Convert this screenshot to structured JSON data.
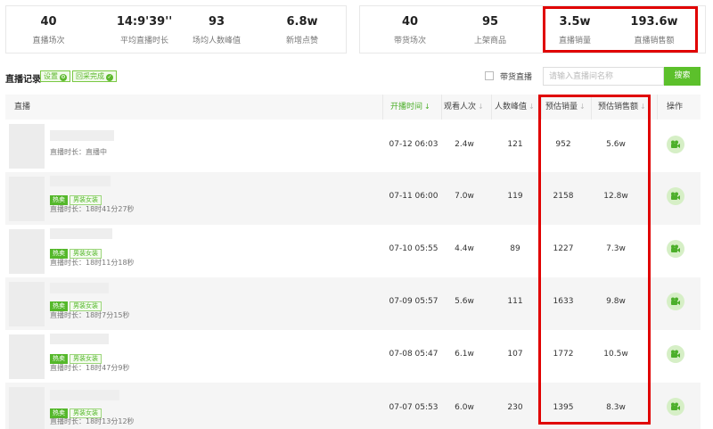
{
  "stats_left": [
    {
      "value": "40",
      "label": "直播场次"
    },
    {
      "value": "14:9'39''",
      "label": "平均直播时长"
    },
    {
      "value": "93",
      "label": "场均人数峰值"
    },
    {
      "value": "6.8w",
      "label": "新增点赞"
    }
  ],
  "stats_right": [
    {
      "value": "40",
      "label": "带货场次"
    },
    {
      "value": "95",
      "label": "上架商品"
    },
    {
      "value": "3.5w",
      "label": "直播销量"
    },
    {
      "value": "193.6w",
      "label": "直播销售额"
    }
  ],
  "toolbar": {
    "title": "直播记录",
    "settings_label": "设置",
    "settings_mark": "⚙",
    "collect_label": "回采完成",
    "collect_mark": "✓",
    "checkbox_label": "带货直播",
    "search_placeholder": "请输入直播间名称",
    "search_label": "搜索"
  },
  "table": {
    "headers": {
      "live": "直播",
      "start_time": "开播时间",
      "views": "观看人次",
      "peak": "人数峰值",
      "sales": "预估销量",
      "amount": "预估销售额",
      "action": "操作"
    },
    "sort_icon": "↓",
    "rows": [
      {
        "hot": "",
        "category": "",
        "duration": "直播时长：直播中",
        "start_time": "07-12 06:03",
        "views": "2.4w",
        "peak": "121",
        "sales": "952",
        "amount": "5.6w"
      },
      {
        "hot": "热卖",
        "category": "男装女装",
        "duration": "直播时长：18时41分27秒",
        "start_time": "07-11 06:00",
        "views": "7.0w",
        "peak": "119",
        "sales": "2158",
        "amount": "12.8w"
      },
      {
        "hot": "热卖",
        "category": "男装女装",
        "duration": "直播时长：18时11分18秒",
        "start_time": "07-10 05:55",
        "views": "4.4w",
        "peak": "89",
        "sales": "1227",
        "amount": "7.3w"
      },
      {
        "hot": "热卖",
        "category": "男装女装",
        "duration": "直播时长：18时7分15秒",
        "start_time": "07-09 05:57",
        "views": "5.6w",
        "peak": "111",
        "sales": "1633",
        "amount": "9.8w"
      },
      {
        "hot": "热卖",
        "category": "男装女装",
        "duration": "直播时长：18时47分9秒",
        "start_time": "07-08 05:47",
        "views": "6.1w",
        "peak": "107",
        "sales": "1772",
        "amount": "10.5w"
      },
      {
        "hot": "热卖",
        "category": "男装女装",
        "duration": "直播时长：18时13分12秒",
        "start_time": "07-07 05:53",
        "views": "6.0w",
        "peak": "230",
        "sales": "1395",
        "amount": "8.3w"
      }
    ]
  },
  "colors": {
    "accent": "#5cc02b",
    "highlight": "#e00000"
  },
  "icons": {
    "row_action": "video-camera-icon"
  }
}
